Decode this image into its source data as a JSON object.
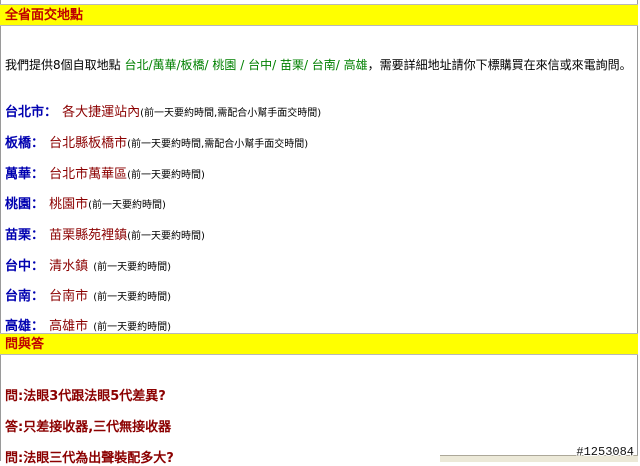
{
  "section1": {
    "title": "全省面交地點"
  },
  "intro": {
    "prefix": "我們提供8個自取地點",
    "areas": "台北/萬華/板橋/ 桃園 / 台中/ 苗栗/ 台南/ 高雄",
    "suffix": "，需要詳細地址請你下標購買在來信或來電詢問。"
  },
  "locations": [
    {
      "city": "台北市：",
      "place": "各大捷運站內",
      "note": "(前一天要約時間,需配合小幫手面交時間)"
    },
    {
      "city": "板橋：",
      "place": "台北縣板橋市",
      "note": "(前一天要約時間,需配合小幫手面交時間)"
    },
    {
      "city": "萬華：",
      "place": "台北市萬華區",
      "note": "(前一天要約時間)"
    },
    {
      "city": "桃園：",
      "place": "桃園市",
      "note": "(前一天要約時間)"
    },
    {
      "city": "苗栗：",
      "place": "苗栗縣苑裡鎮",
      "note": "(前一天要約時間)"
    },
    {
      "city": "台中：",
      "place": "清水鎮",
      "note": "(前一天要約時間)"
    },
    {
      "city": "台南：",
      "place": "台南市",
      "note": "(前一天要約時間)"
    },
    {
      "city": "高雄：",
      "place": "高雄市",
      "note": "(前一天要約時間)"
    }
  ],
  "section2": {
    "title": "問與答"
  },
  "qa": [
    {
      "text": "問:法眼3代跟法眼5代差異?"
    },
    {
      "text": "答:只差接收器,三代無接收器"
    },
    {
      "text": "問:法眼三代為出聲裝配多大?"
    }
  ],
  "watermark": "#1253084"
}
